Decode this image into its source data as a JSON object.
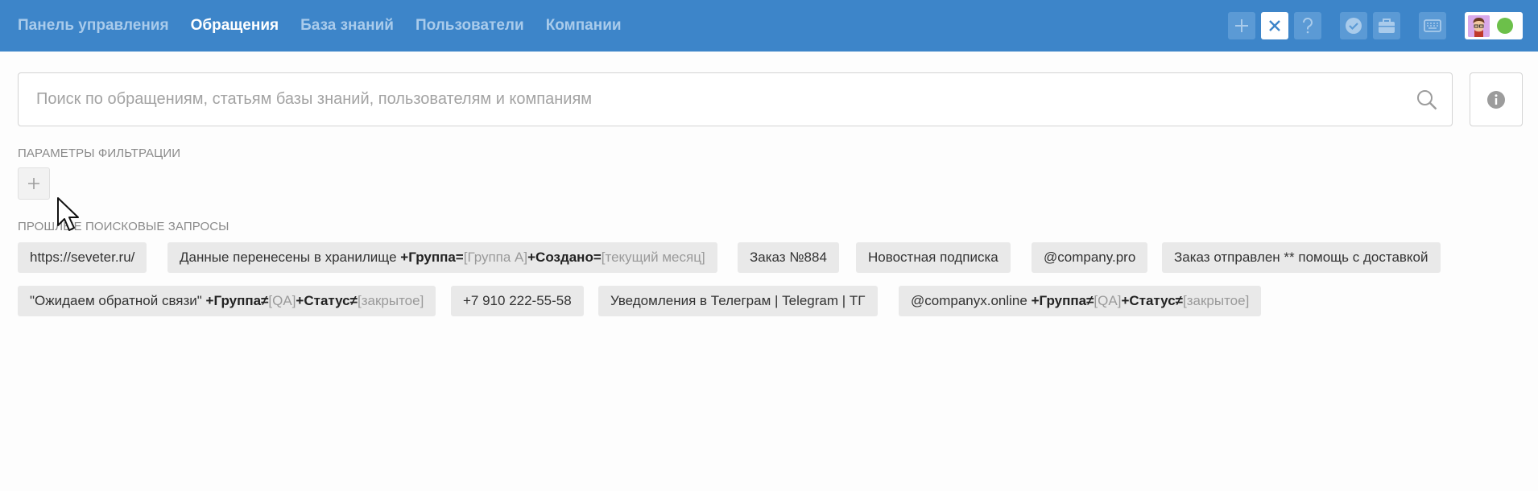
{
  "nav": {
    "items": [
      {
        "label": "Панель управления",
        "active": false
      },
      {
        "label": "Обращения",
        "active": true
      },
      {
        "label": "База знаний",
        "active": false
      },
      {
        "label": "Пользователи",
        "active": false
      },
      {
        "label": "Компании",
        "active": false
      }
    ]
  },
  "toolbar": {
    "icons": [
      "plus-icon",
      "close-icon",
      "question-icon",
      "check-badge-icon",
      "briefcase-icon",
      "keyboard-icon"
    ],
    "accent_color": "#3d85c9",
    "status_color": "#6cc04a"
  },
  "search": {
    "placeholder": "Поиск по обращениям, статьям базы знаний, пользователям и компаниям",
    "value": ""
  },
  "filters": {
    "title": "Параметры фильтрации"
  },
  "history": {
    "title": "Прошлые поисковые запросы",
    "queries": [
      {
        "parts": [
          {
            "t": "text",
            "v": "https://seveter.ru/"
          }
        ]
      },
      {
        "parts": [
          {
            "t": "text",
            "v": "Данные перенесены в хранилище "
          },
          {
            "t": "bold",
            "v": "+Группа="
          },
          {
            "t": "mute",
            "v": "[Группа А]"
          },
          {
            "t": "bold",
            "v": "+Создано="
          },
          {
            "t": "mute",
            "v": "[текущий месяц]"
          }
        ]
      },
      {
        "parts": [
          {
            "t": "text",
            "v": "Заказ №884"
          }
        ]
      },
      {
        "parts": [
          {
            "t": "text",
            "v": "Новостная подписка"
          }
        ]
      },
      {
        "parts": [
          {
            "t": "text",
            "v": "@company.pro"
          }
        ]
      },
      {
        "parts": [
          {
            "t": "text",
            "v": "Заказ отправлен ** помощь с доставкой"
          }
        ]
      },
      {
        "parts": [
          {
            "t": "text",
            "v": "\"Ожидаем обратной связи\" "
          },
          {
            "t": "bold",
            "v": "+Группа≠"
          },
          {
            "t": "mute",
            "v": "[QA]"
          },
          {
            "t": "bold",
            "v": "+Статус≠"
          },
          {
            "t": "mute",
            "v": "[закрытое]"
          }
        ]
      },
      {
        "parts": [
          {
            "t": "text",
            "v": "+7 910 222-55-58"
          }
        ]
      },
      {
        "parts": [
          {
            "t": "text",
            "v": "Уведомления в Телеграм | Telegram | ТГ"
          }
        ]
      },
      {
        "parts": [
          {
            "t": "text",
            "v": "@companyx.online "
          },
          {
            "t": "bold",
            "v": "+Группа≠"
          },
          {
            "t": "mute",
            "v": "[QA]"
          },
          {
            "t": "bold",
            "v": "+Статус≠"
          },
          {
            "t": "mute",
            "v": "[закрытое]"
          }
        ]
      }
    ]
  }
}
